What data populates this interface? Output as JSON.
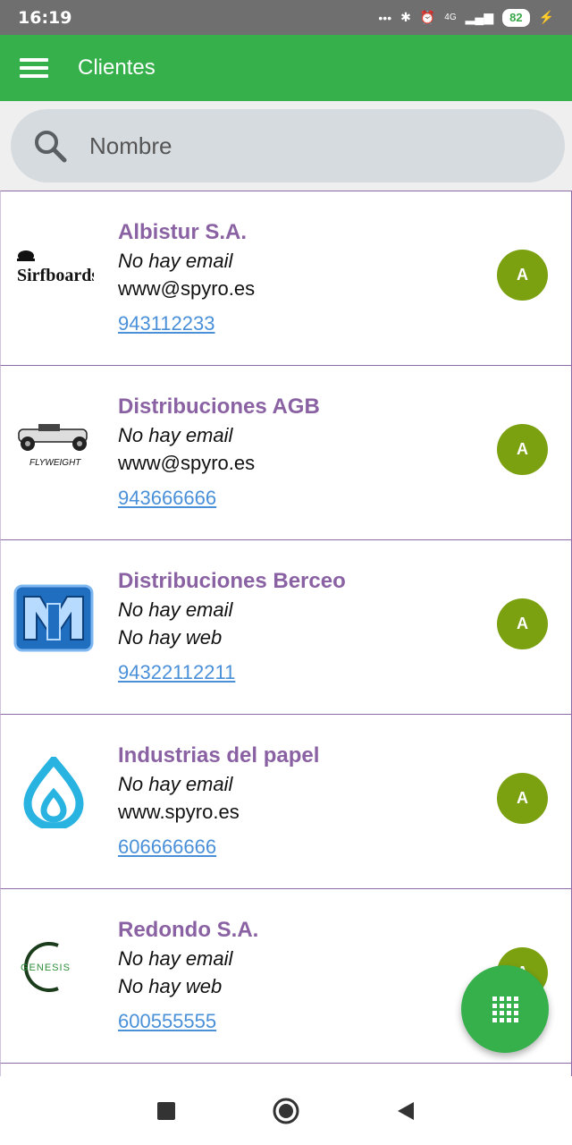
{
  "status": {
    "time": "16:19",
    "signal": "4G",
    "battery": "82"
  },
  "app_bar": {
    "title": "Clientes",
    "menu_icon": "hamburger-menu-icon"
  },
  "search": {
    "placeholder": "Nombre",
    "icon": "search-icon"
  },
  "clients": [
    {
      "name": "Albistur S.A.",
      "email": "No hay email",
      "web": "www@spyro.es",
      "phone": "943112233",
      "avatar": "A",
      "logo_text": "Sirfboards"
    },
    {
      "name": "Distribuciones AGB",
      "email": "No hay email",
      "web": "www@spyro.es",
      "phone": "943666666",
      "avatar": "A",
      "logo_text": "FLYWEIGHT"
    },
    {
      "name": "Distribuciones Berceo",
      "email": "No hay email",
      "web": "No hay web",
      "phone": "94322112211",
      "avatar": "A",
      "logo_text": ""
    },
    {
      "name": "Industrias del papel",
      "email": "No hay email",
      "web": "www.spyro.es",
      "phone": "606666666",
      "avatar": "A",
      "logo_text": ""
    },
    {
      "name": "Redondo S.A.",
      "email": "No hay email",
      "web": "No hay web",
      "phone": "600555555",
      "avatar": "A",
      "logo_text": "GENESIS"
    }
  ],
  "colors": {
    "app_bar": "#35b04b",
    "name": "#8a62a3",
    "avatar": "#7ba111",
    "phone_link": "#4a90d9"
  }
}
